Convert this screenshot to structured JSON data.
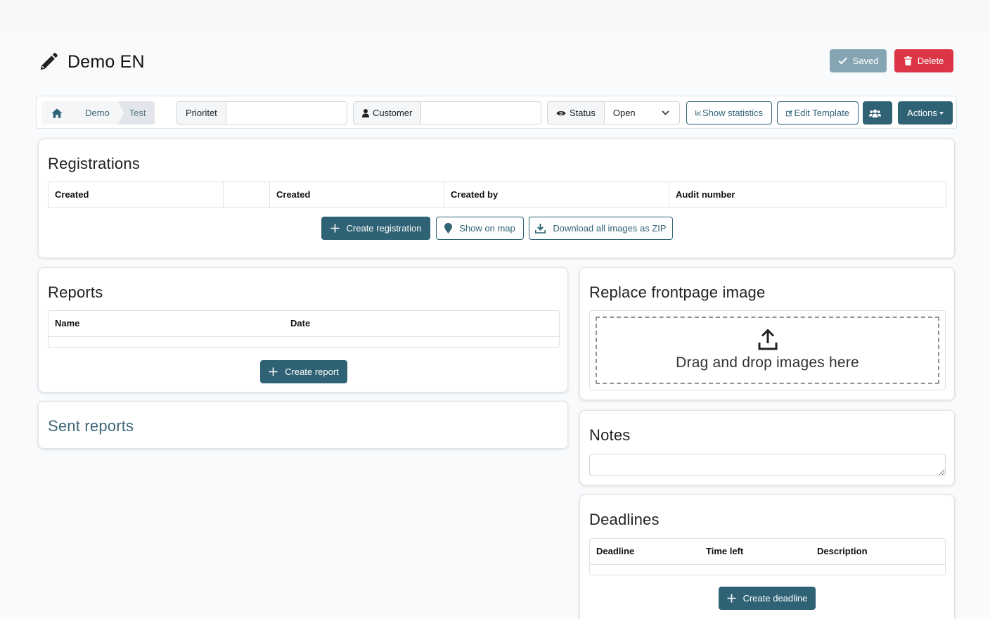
{
  "header": {
    "title": "Demo EN",
    "saved_label": "Saved",
    "delete_label": "Delete"
  },
  "breadcrumb": {
    "items": [
      "Demo",
      "Test"
    ]
  },
  "toolbar": {
    "priority_label": "Prioritet",
    "priority_value": "",
    "customer_label": "Customer",
    "customer_value": "",
    "status_label": "Status",
    "status_value": "Open",
    "show_statistics": "Show statistics",
    "edit_template": "Edit Template",
    "actions": "Actions"
  },
  "registrations": {
    "title": "Registrations",
    "columns": [
      "Created",
      "",
      "Created",
      "Created by",
      "Audit number"
    ],
    "create_label": "Create registration",
    "map_label": "Show on map",
    "zip_label": "Download all images as ZIP"
  },
  "reports": {
    "title": "Reports",
    "columns": [
      "Name",
      "Date"
    ],
    "create_label": "Create report"
  },
  "sent_reports": {
    "title": "Sent reports"
  },
  "frontpage": {
    "title": "Replace frontpage image",
    "drop_text": "Drag and drop images here"
  },
  "notes": {
    "title": "Notes",
    "value": ""
  },
  "deadlines": {
    "title": "Deadlines",
    "columns": [
      "Deadline",
      "Time left",
      "Description"
    ],
    "create_label": "Create deadline"
  },
  "colors": {
    "primary": "#2f6275",
    "danger": "#dc3545",
    "saved": "#86a5b3"
  }
}
